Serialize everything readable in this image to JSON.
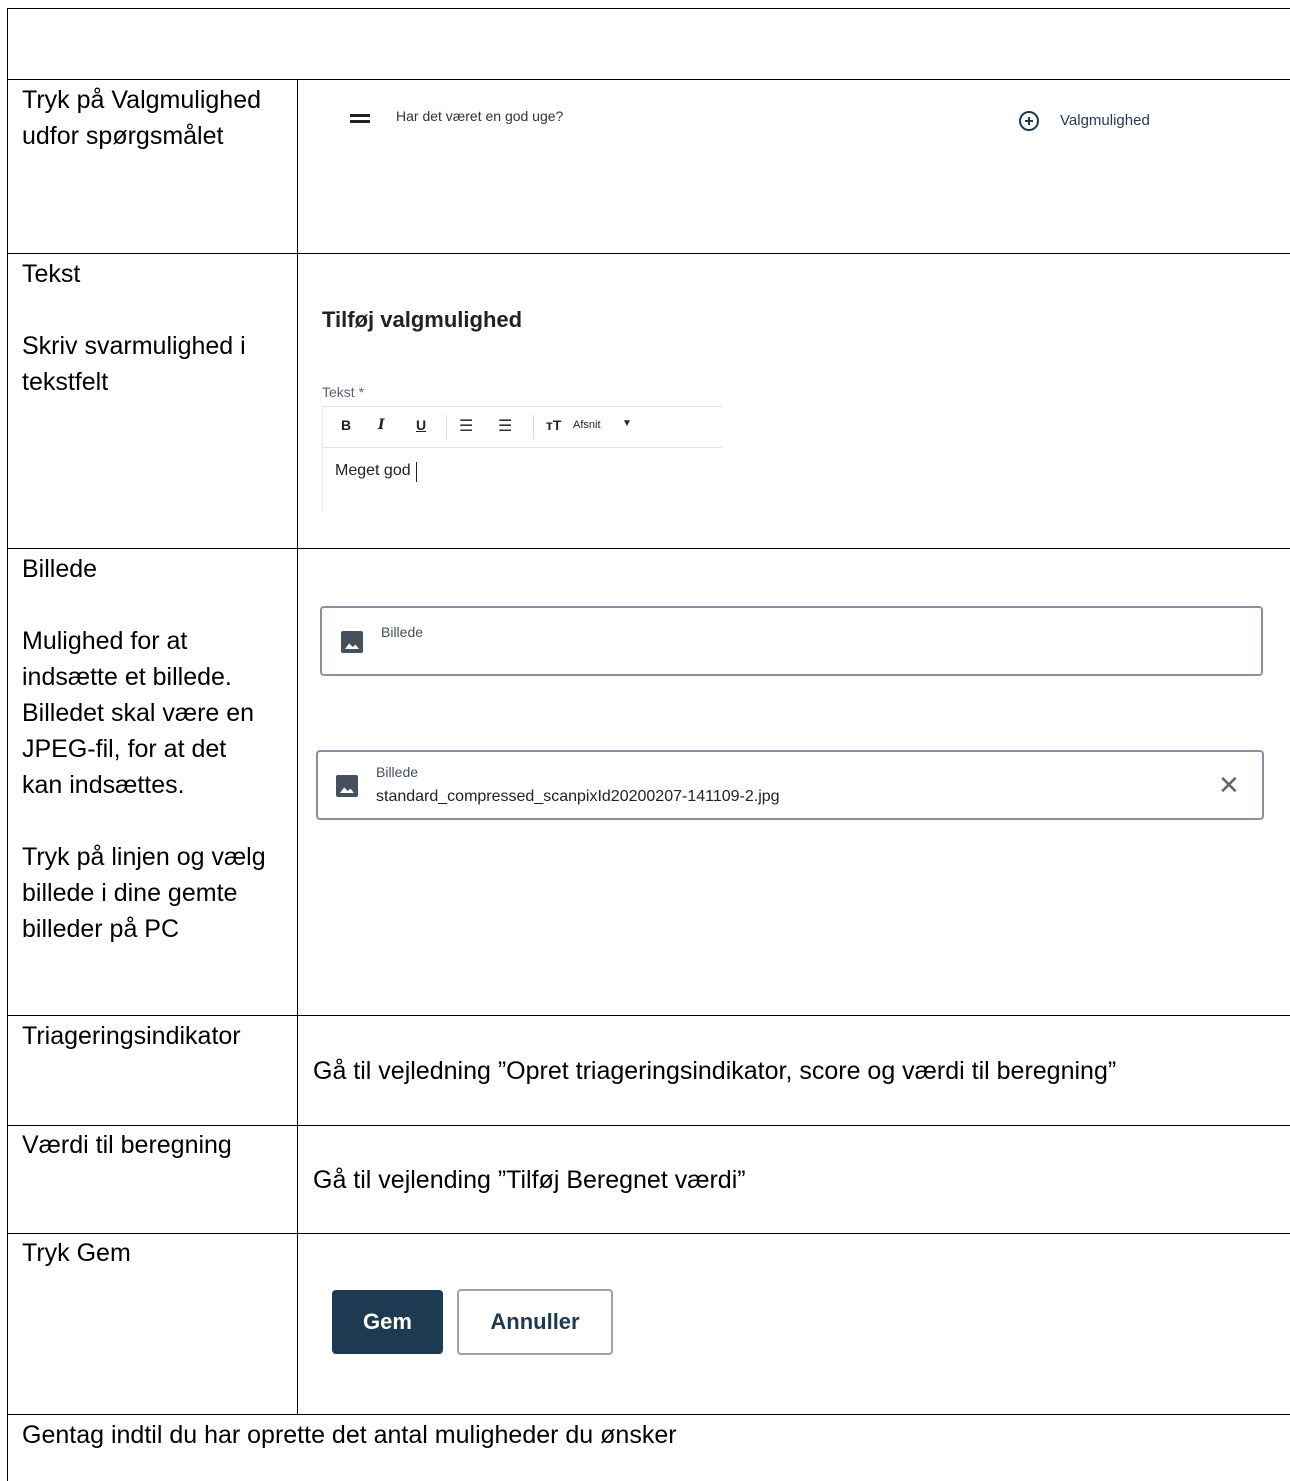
{
  "rows": {
    "step1": {
      "label_line1": "Tryk på Valgmulighed",
      "label_line2": "udfor spørgsmålet"
    },
    "step2": {
      "label_title": "Tekst",
      "label_line1": "Skriv svarmulighed i",
      "label_line2": "tekstfelt"
    },
    "step3": {
      "label_title": "Billede",
      "label_lines": [
        "Mulighed for at",
        "indsætte et billede.",
        "Billedet skal være en",
        "JPEG-fil, for at det",
        "kan indsættes."
      ],
      "label_lines2": [
        "Tryk på linjen og vælg",
        "billede i dine gemte",
        "billeder på PC"
      ]
    },
    "step4": {
      "label": "Triageringsindikator",
      "content": "Gå til vejledning ”Opret triageringsindikator, score og værdi til beregning”"
    },
    "step5": {
      "label": "Værdi til beregning",
      "content": "Gå til vejlending ”Tilføj Beregnet værdi”"
    },
    "step6": {
      "label": "Tryk Gem"
    },
    "footer": {
      "text": "Gentag indtil du har oprette det antal muligheder du ønsker"
    }
  },
  "screens": {
    "question_row": {
      "question": "Har det været en god uge?",
      "add_option_label": "Valgmulighed",
      "icon": "drag-handle-icon"
    },
    "add_option_dialog": {
      "title": "Tilføj valgmulighed",
      "field_label": "Tekst *",
      "toolbar": {
        "bold": "B",
        "italic": "I",
        "underline": "U",
        "paragraph": "Afsnit"
      },
      "editor_value": "Meget god"
    },
    "image_field_empty": {
      "label": "Billede"
    },
    "image_field_filled": {
      "label": "Billede",
      "file_name": "standard_compressed_scanpixId20200207-141109-2.jpg"
    },
    "buttons": {
      "save": "Gem",
      "cancel": "Annuller"
    }
  },
  "colors": {
    "primary": "#1e3a52",
    "border": "#000000",
    "field_border": "#8391a0"
  }
}
